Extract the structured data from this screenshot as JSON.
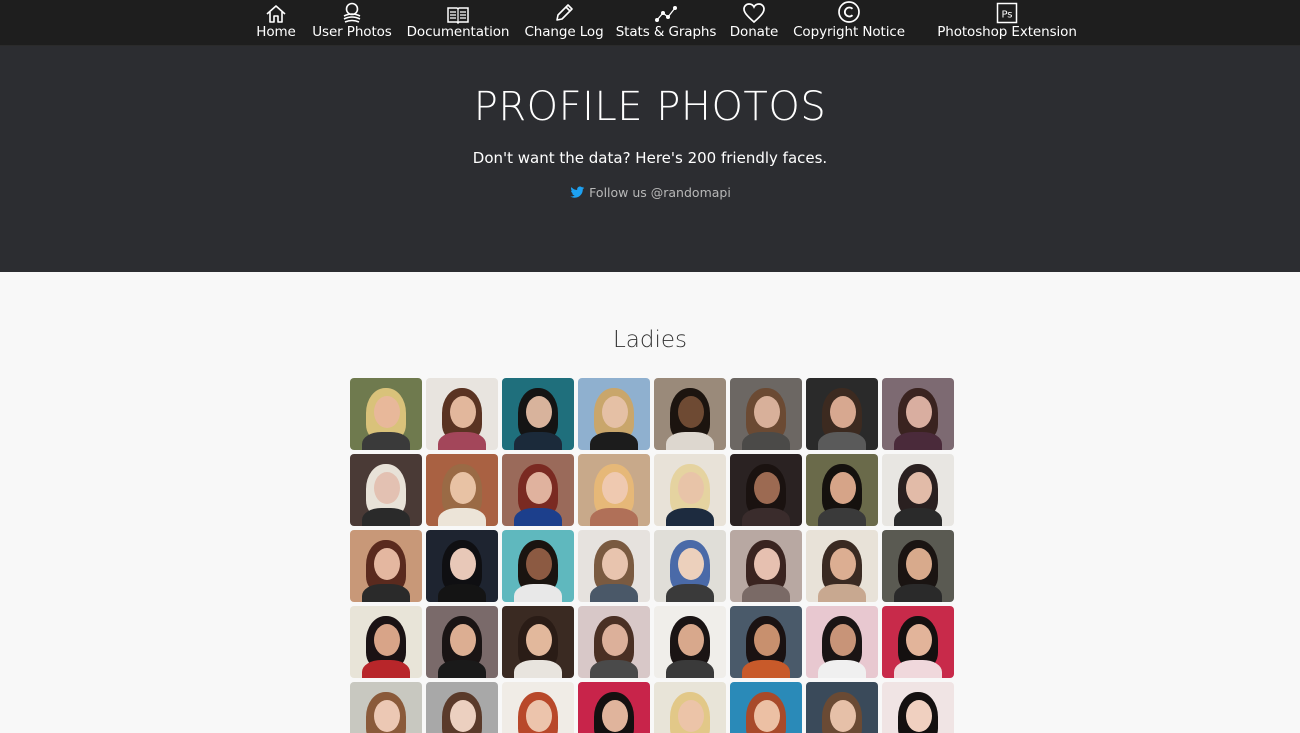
{
  "nav": [
    {
      "label": "Home",
      "icon": "home-icon"
    },
    {
      "label": "User Photos",
      "icon": "user-photos-icon"
    },
    {
      "label": "Documentation",
      "icon": "book-icon"
    },
    {
      "label": "Change Log",
      "icon": "pencil-icon"
    },
    {
      "label": "Stats & Graphs",
      "icon": "graph-icon"
    },
    {
      "label": "Donate",
      "icon": "heart-icon"
    },
    {
      "label": "Copyright Notice",
      "icon": "copyright-icon"
    },
    {
      "label": "Photoshop Extension",
      "icon": "photoshop-icon",
      "icon_text": "Ps"
    }
  ],
  "hero": {
    "title": "PROFILE PHOTOS",
    "subtitle": "Don't want the data? Here's 200 friendly faces.",
    "follow": "Follow us @randomapi"
  },
  "section": {
    "title": "Ladies"
  },
  "colors": {
    "nav_bg": "#1e1e1e",
    "hero_bg": "#2c2d31",
    "page_bg": "#f8f8f8",
    "twitter_blue": "#1da1f2"
  },
  "photos": [
    {
      "bg": "#6f7a4e",
      "hair": "#d9c27a",
      "skin": "#e8b89a",
      "shirt": "#3a3a3a"
    },
    {
      "bg": "#e8e4df",
      "hair": "#5a3322",
      "skin": "#e2b79c",
      "shirt": "#a3465a"
    },
    {
      "bg": "#1f6f7c",
      "hair": "#141414",
      "skin": "#d8b39c",
      "shirt": "#1b2a3a"
    },
    {
      "bg": "#8fb0cf",
      "hair": "#c9a66b",
      "skin": "#e5c0a5",
      "shirt": "#1c1c1c"
    },
    {
      "bg": "#9a8a7a",
      "hair": "#1c140f",
      "skin": "#6e4a33",
      "shirt": "#ddd7cf"
    },
    {
      "bg": "#6c6763",
      "hair": "#6b4a33",
      "skin": "#d8b09a",
      "shirt": "#4b4a48"
    },
    {
      "bg": "#2a2a2a",
      "hair": "#3c2a20",
      "skin": "#d7a890",
      "shirt": "#5a5a5a"
    },
    {
      "bg": "#7d6a72",
      "hair": "#3a2320",
      "skin": "#d9aea0",
      "shirt": "#4a2a3a"
    },
    {
      "bg": "#4a3a36",
      "hair": "#e8e2d8",
      "skin": "#e3c1b2",
      "shirt": "#2a2a2a"
    },
    {
      "bg": "#a96142",
      "hair": "#9a6a45",
      "skin": "#e8c2a4",
      "shirt": "#ece4d8"
    },
    {
      "bg": "#9a6a5a",
      "hair": "#7a2a22",
      "skin": "#e0b29e",
      "shirt": "#1c3f8c"
    },
    {
      "bg": "#c8a98a",
      "hair": "#e6b878",
      "skin": "#efc9b0",
      "shirt": "#b07058"
    },
    {
      "bg": "#e8e2d8",
      "hair": "#e5d3a0",
      "skin": "#e8c4a8",
      "shirt": "#1d2b3f"
    },
    {
      "bg": "#2a2222",
      "hair": "#1a1210",
      "skin": "#9c6a52",
      "shirt": "#3a2c2c"
    },
    {
      "bg": "#6a6a4a",
      "hair": "#15110e",
      "skin": "#d6a488",
      "shirt": "#3a3a3a"
    },
    {
      "bg": "#e8e6e2",
      "hair": "#2a2020",
      "skin": "#e2bba8",
      "shirt": "#2a2a2a"
    },
    {
      "bg": "#c89878",
      "hair": "#5a2a1e",
      "skin": "#e4b7a0",
      "shirt": "#2a2a2a"
    },
    {
      "bg": "#1e2430",
      "hair": "#0f0f12",
      "skin": "#e8c8b8",
      "shirt": "#141414"
    },
    {
      "bg": "#5fb8be",
      "hair": "#1a1410",
      "skin": "#8c5a42",
      "shirt": "#e8e8e8"
    },
    {
      "bg": "#e6e2de",
      "hair": "#7a5a40",
      "skin": "#e8c4ae",
      "shirt": "#4a5868"
    },
    {
      "bg": "#e0ded8",
      "hair": "#4a6aa8",
      "skin": "#ecd0bc",
      "shirt": "#3a3a3a"
    },
    {
      "bg": "#b8a8a2",
      "hair": "#3a2420",
      "skin": "#e6c0b0",
      "shirt": "#7a6a66"
    },
    {
      "bg": "#e8e2d8",
      "hair": "#3a2a22",
      "skin": "#dcae92",
      "shirt": "#c8a890"
    },
    {
      "bg": "#5a5a52",
      "hair": "#1a1412",
      "skin": "#d8aa8c",
      "shirt": "#2a2a2a"
    },
    {
      "bg": "#e8e4d8",
      "hair": "#1a1214",
      "skin": "#d8a488",
      "shirt": "#b8262a"
    },
    {
      "bg": "#7a6a6a",
      "hair": "#1a1414",
      "skin": "#dcae92",
      "shirt": "#1a1a1a"
    },
    {
      "bg": "#3a2a22",
      "hair": "#2a1c16",
      "skin": "#e2b89c",
      "shirt": "#e8e4de"
    },
    {
      "bg": "#d8c8c8",
      "hair": "#4a3024",
      "skin": "#dcb09a",
      "shirt": "#4a4a4a"
    },
    {
      "bg": "#f0eeea",
      "hair": "#1a1414",
      "skin": "#d8a88c",
      "shirt": "#3a3a3a"
    },
    {
      "bg": "#4a5a6a",
      "hair": "#1a1212",
      "skin": "#c8906e",
      "shirt": "#c85a2a"
    },
    {
      "bg": "#e8c8d0",
      "hair": "#1a1414",
      "skin": "#c89478",
      "shirt": "#f0f0f0"
    },
    {
      "bg": "#c82a4a",
      "hair": "#141010",
      "skin": "#e2b49a",
      "shirt": "#f0d8dc"
    },
    {
      "bg": "#c8c8c0",
      "hair": "#8a5a3a",
      "skin": "#ecc8b4",
      "shirt": "#3a3a3a"
    },
    {
      "bg": "#a8a8a8",
      "hair": "#5a3a2a",
      "skin": "#ecd0c0",
      "shirt": "#2a2a2a"
    },
    {
      "bg": "#f0ece6",
      "hair": "#b8482a",
      "skin": "#ecc4ac",
      "shirt": "#2a2a2a"
    },
    {
      "bg": "#c8244a",
      "hair": "#141010",
      "skin": "#e0b49c",
      "shirt": "#3a1a2a"
    },
    {
      "bg": "#e8e4d8",
      "hair": "#e2c888",
      "skin": "#ecc4a8",
      "shirt": "#8a9ab8"
    },
    {
      "bg": "#2a8ab8",
      "hair": "#a84a2a",
      "skin": "#ecc0a4",
      "shirt": "#f0f0f0"
    },
    {
      "bg": "#3a4a5a",
      "hair": "#6a4a34",
      "skin": "#e6c0a8",
      "shirt": "#2a2a2a"
    },
    {
      "bg": "#f0e4e4",
      "hair": "#141010",
      "skin": "#f0d0c0",
      "shirt": "#e8e0e0"
    }
  ]
}
